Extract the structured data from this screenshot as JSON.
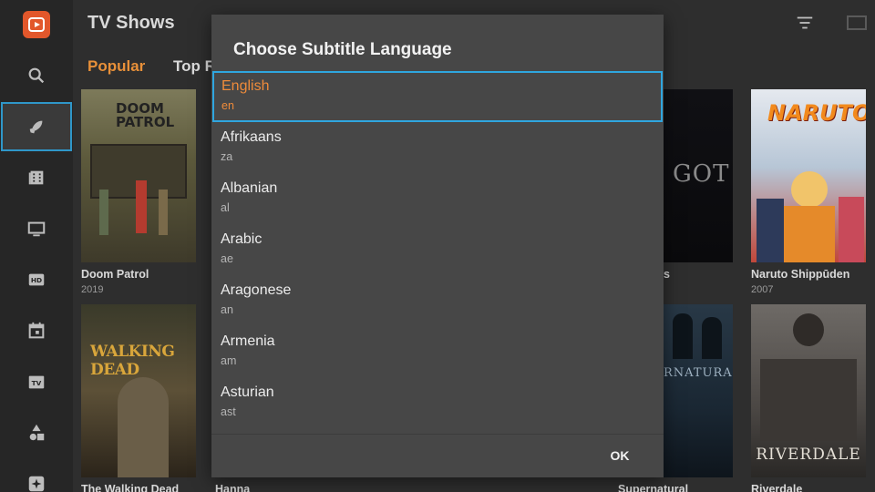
{
  "header": {
    "title": "TV Shows"
  },
  "tabs": [
    {
      "label": "Popular"
    },
    {
      "label": "Top R"
    }
  ],
  "sidebar": {
    "items": [
      {
        "icon": "search-icon"
      },
      {
        "icon": "rocket-icon"
      },
      {
        "icon": "film-icon"
      },
      {
        "icon": "monitor-icon"
      },
      {
        "icon": "hd-icon"
      },
      {
        "icon": "calendar-icon"
      },
      {
        "icon": "tv-icon"
      },
      {
        "icon": "shapes-icon"
      },
      {
        "icon": "sparkle-icon"
      }
    ]
  },
  "shows": [
    {
      "title": "Doom Patrol",
      "year": "2019",
      "poster_text": "DOOM PATROL"
    },
    {
      "title": "f Thrones",
      "year": "",
      "poster_text": "GOT"
    },
    {
      "title": "Naruto Shippūden",
      "year": "2007",
      "poster_text": "NARUTO"
    },
    {
      "title": "The Walking Dead",
      "year": "",
      "poster_text": "WALKING DEAD"
    },
    {
      "title": "Hanna",
      "year": "",
      "poster_text": ""
    },
    {
      "title": "Supernatural",
      "year": "",
      "poster_text": "RNATURAL"
    },
    {
      "title": "Riverdale",
      "year": "",
      "poster_text": "RIVERDALE"
    }
  ],
  "dialog": {
    "title": "Choose Subtitle Language",
    "languages": [
      {
        "name": "English",
        "code": "en",
        "selected": true
      },
      {
        "name": "Afrikaans",
        "code": "za"
      },
      {
        "name": "Albanian",
        "code": "al"
      },
      {
        "name": "Arabic",
        "code": "ae"
      },
      {
        "name": "Aragonese",
        "code": "an"
      },
      {
        "name": "Armenia",
        "code": "am"
      },
      {
        "name": "Asturian",
        "code": "ast"
      }
    ],
    "ok_label": "OK"
  },
  "colors": {
    "accent_orange": "#ef8b3a",
    "focus_blue": "#2fa6df",
    "dialog_bg": "#474747",
    "app_bg": "#2e2e2e"
  }
}
